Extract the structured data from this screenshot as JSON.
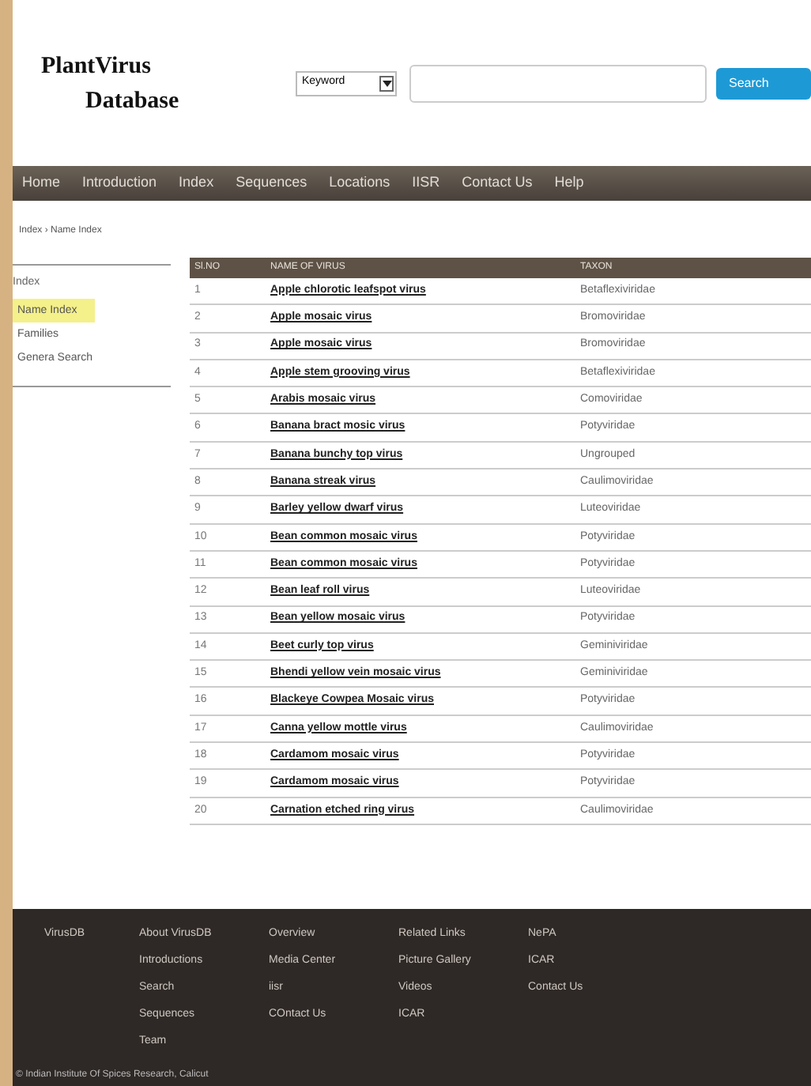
{
  "logo": {
    "line_1": "PlantVirus",
    "line_2": "Database"
  },
  "search": {
    "filter": "Keyword",
    "button": "Search"
  },
  "nav": [
    "Home",
    "Introduction",
    "Index",
    "Sequences",
    "Locations",
    "IISR",
    "Contact Us",
    "Help"
  ],
  "breadcrumb": "Index › Name Index",
  "sidebar": {
    "title": "Index",
    "items": [
      {
        "label": "Name Index",
        "selected": true
      },
      {
        "label": "Families",
        "selected": false
      },
      {
        "label": "Genera Search",
        "selected": false
      }
    ]
  },
  "table": {
    "columns": [
      "Sl.NO",
      "NAME OF VIRUS",
      "TAXON"
    ],
    "rows": [
      [
        "1",
        "Apple chlorotic leafspot virus",
        "Betaflexiviridae"
      ],
      [
        "2",
        "Apple mosaic virus",
        "Bromoviridae"
      ],
      [
        "3",
        "Apple mosaic virus",
        "Bromoviridae"
      ],
      [
        "4",
        "Apple stem grooving virus",
        "Betaflexiviridae"
      ],
      [
        "5",
        "Arabis mosaic virus",
        "Comoviridae"
      ],
      [
        "6",
        "Banana bract mosic virus",
        "Potyviridae"
      ],
      [
        "7",
        "Banana bunchy top virus",
        "Ungrouped"
      ],
      [
        "8",
        "Banana streak virus",
        "Caulimoviridae"
      ],
      [
        "9",
        "Barley yellow dwarf virus",
        "Luteoviridae"
      ],
      [
        "10",
        "Bean common mosaic virus",
        "Potyviridae"
      ],
      [
        "11",
        "Bean common mosaic virus",
        "Potyviridae"
      ],
      [
        "12",
        "Bean leaf roll virus",
        "Luteoviridae"
      ],
      [
        "13",
        "Bean yellow mosaic virus",
        "Potyviridae"
      ],
      [
        "14",
        "Beet curly top virus",
        "Geminiviridae"
      ],
      [
        "15",
        "Bhendi yellow vein mosaic virus",
        "Geminiviridae"
      ],
      [
        "16",
        "Blackeye Cowpea Mosaic virus",
        "Potyviridae"
      ],
      [
        "17",
        "Canna yellow mottle virus",
        "Caulimoviridae"
      ],
      [
        "18",
        "Cardamom mosaic virus",
        "Potyviridae"
      ],
      [
        "19",
        "Cardamom mosaic virus",
        "Potyviridae"
      ],
      [
        "20",
        "Carnation etched ring virus",
        "Caulimoviridae"
      ]
    ]
  },
  "footer": {
    "columns": [
      [
        "VirusDB"
      ],
      [
        "About VirusDB",
        "Introductions",
        "Search",
        "Sequences",
        "Team"
      ],
      [
        "Overview",
        "Media Center",
        "iisr",
        "COntact Us"
      ],
      [
        "Related Links",
        "Picture Gallery",
        "Videos",
        "ICAR"
      ],
      [
        "NePA",
        "ICAR",
        "Contact Us"
      ]
    ],
    "copyright": "© Indian Institute Of Spices Research, Calicut"
  }
}
